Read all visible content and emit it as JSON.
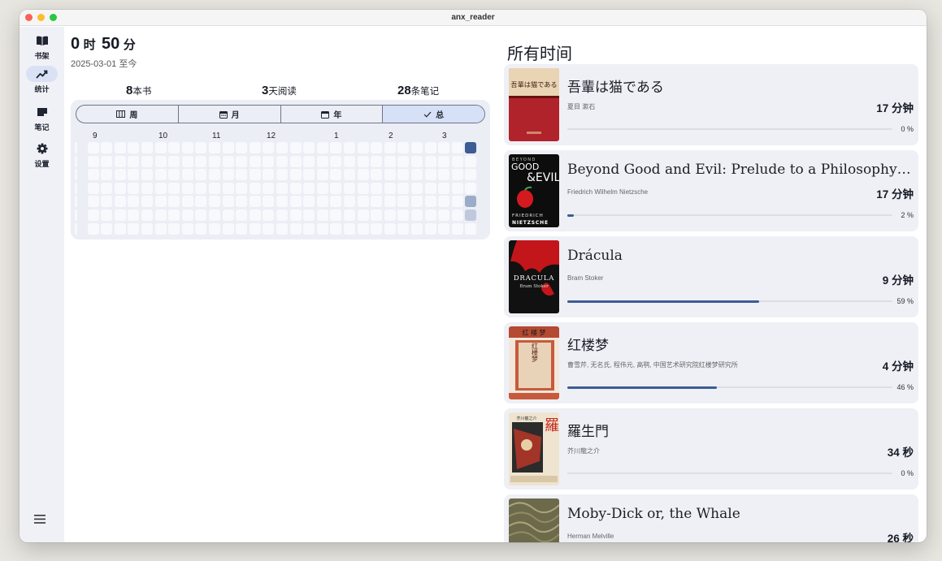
{
  "window": {
    "title": "anx_reader"
  },
  "sidebar": {
    "items": [
      {
        "label": "书架",
        "icon": "book-open-icon"
      },
      {
        "label": "统计",
        "icon": "trend-line-icon"
      },
      {
        "label": "笔记",
        "icon": "note-icon"
      },
      {
        "label": "设置",
        "icon": "gear-icon"
      }
    ],
    "active": 1,
    "menu_icon": "hamburger-menu-icon"
  },
  "summary": {
    "hours": "0",
    "hours_unit": "时",
    "minutes": "50",
    "minutes_unit": "分",
    "range": "2025-03-01 至今",
    "books_count": "8",
    "books_label": "本书",
    "days_count": "3",
    "days_label": "天阅读",
    "notes_count": "28",
    "notes_label": "条笔记"
  },
  "period_tabs": {
    "items": [
      {
        "label": "周",
        "icon": "week-grid-icon"
      },
      {
        "label": "月",
        "icon": "calendar-month-icon"
      },
      {
        "label": "年",
        "icon": "calendar-year-icon"
      },
      {
        "label": "总",
        "icon": "check-icon"
      }
    ],
    "selected": 3
  },
  "heatmap": {
    "months": [
      "9",
      "10",
      "11",
      "12",
      "1",
      "2",
      "3"
    ],
    "highlights": [
      {
        "col": 29,
        "row": 0,
        "level": 1.0
      },
      {
        "col": 29,
        "row": 4,
        "level": 0.45
      },
      {
        "col": 29,
        "row": 5,
        "level": 0.25
      }
    ],
    "colors": {
      "empty": "#f8f9fc",
      "accent": "#3c5c93"
    }
  },
  "all_time": {
    "title": "所有时间",
    "books": [
      {
        "title": "吾輩は猫である",
        "author": "夏目 漱石",
        "time": "17 分钟",
        "progress": 0,
        "progress_label": "0 %",
        "cover": "cover-neko"
      },
      {
        "title": "Beyond Good and Evil: Prelude to a Philosophy of the Future",
        "author": "Friedrich Wilhelm Nietzsche",
        "time": "17 分钟",
        "progress": 2,
        "progress_label": "2 %",
        "cover": "cover-nietzsche"
      },
      {
        "title": "Drácula",
        "author": "Bram Stoker",
        "time": "9 分钟",
        "progress": 59,
        "progress_label": "59 %",
        "cover": "cover-dracula"
      },
      {
        "title": "红楼梦",
        "author": "曹雪芹, 无名氏, 程伟元, 高鹗, 中国艺术研究院红楼梦研究所",
        "time": "4 分钟",
        "progress": 46,
        "progress_label": "46 %",
        "cover": "cover-hongloumeng"
      },
      {
        "title": "羅生門",
        "author": "芥川龍之介",
        "time": "34 秒",
        "progress": 0,
        "progress_label": "0 %",
        "cover": "cover-rashomon"
      },
      {
        "title": "Moby-Dick or, the Whale",
        "author": "Herman Melville",
        "time": "26 秒",
        "progress": null,
        "progress_label": "",
        "cover": "cover-mobydick"
      }
    ]
  },
  "cover_text": {
    "neko": "吾輩は猫である",
    "nietzsche_top": "BEYOND",
    "nietzsche_good": "GOOD",
    "nietzsche_evil": "&EVIL",
    "nietzsche_name1": "FRIEDRICH",
    "nietzsche_name2": "NIETZSCHE",
    "dracula_title": "DRACULA",
    "dracula_author": "Bram Stoker",
    "hlm_title": "红 楼 梦",
    "hlm_vertical": "红楼梦",
    "rashomon_glyph": "羅",
    "rashomon_name": "芥川龍之介"
  }
}
